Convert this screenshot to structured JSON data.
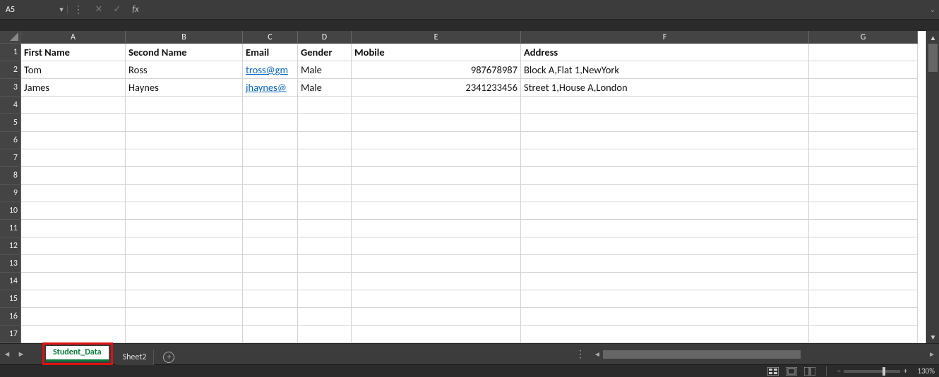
{
  "name_box": {
    "value": "A5"
  },
  "formula": {
    "value": ""
  },
  "columns": [
    "A",
    "B",
    "C",
    "D",
    "E",
    "F",
    "G"
  ],
  "row_count": 17,
  "headers": {
    "A": "First Name",
    "B": "Second Name",
    "C": "Email",
    "D": "Gender",
    "E": "Mobile",
    "F": "Address"
  },
  "rows": [
    {
      "A": "Tom",
      "B": "Ross",
      "C": "tross@gm",
      "D": "Male",
      "E": "987678987",
      "F": "Block A,Flat 1,NewYork"
    },
    {
      "A": "James",
      "B": "Haynes",
      "C": "jhaynes@",
      "D": "Male",
      "E": "2341233456",
      "F": "Street 1,House A,London"
    }
  ],
  "tabs": {
    "active": "Student_Data",
    "others": [
      "Sheet2"
    ]
  },
  "status": {
    "zoom": "130%"
  }
}
